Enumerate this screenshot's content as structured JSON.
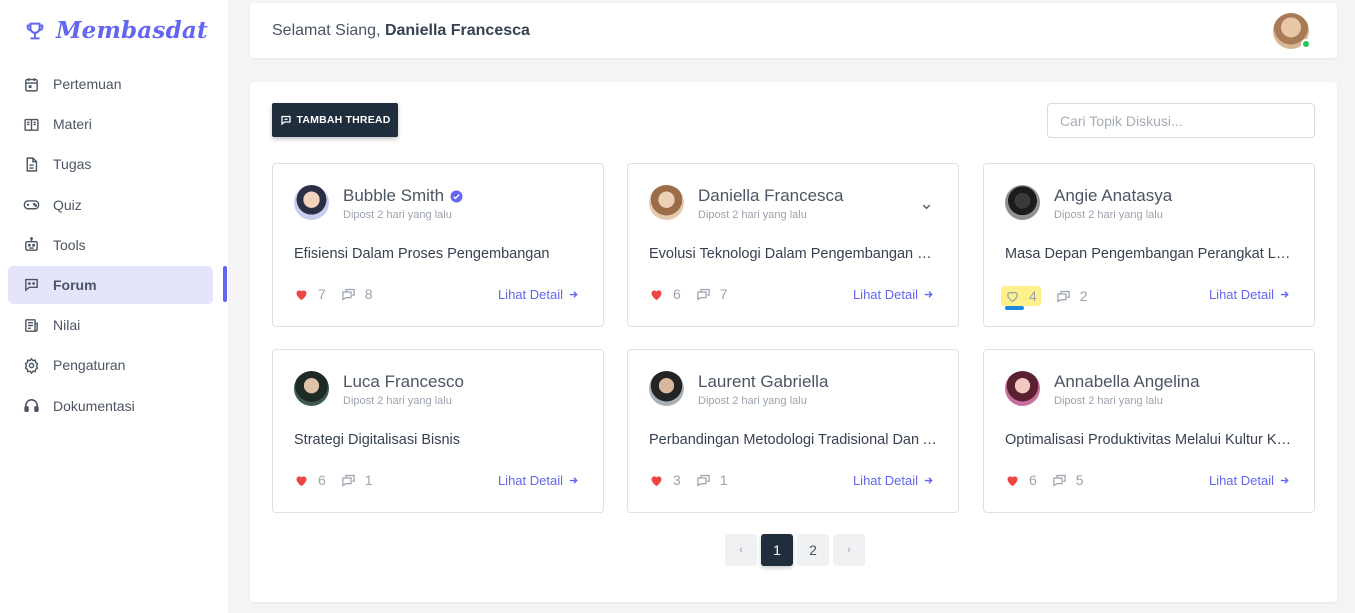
{
  "brand": {
    "name": "Membasdat",
    "accent": "#6366f1"
  },
  "sidebar": {
    "items": [
      {
        "label": "Pertemuan",
        "icon": "calendar-icon",
        "active": false
      },
      {
        "label": "Materi",
        "icon": "book-open-icon",
        "active": false
      },
      {
        "label": "Tugas",
        "icon": "document-icon",
        "active": false
      },
      {
        "label": "Quiz",
        "icon": "gamepad-icon",
        "active": false
      },
      {
        "label": "Tools",
        "icon": "robot-icon",
        "active": false
      },
      {
        "label": "Forum",
        "icon": "chat-icon",
        "active": true
      },
      {
        "label": "Nilai",
        "icon": "report-icon",
        "active": false
      },
      {
        "label": "Pengaturan",
        "icon": "gear-icon",
        "active": false
      },
      {
        "label": "Dokumentasi",
        "icon": "headset-icon",
        "active": false
      }
    ]
  },
  "header": {
    "greeting_prefix": "Selamat Siang, ",
    "user_name": "Daniella Francesca",
    "status_color": "#22c55e"
  },
  "toolbar": {
    "add_thread_label": "TAMBAH THREAD",
    "search_placeholder": "Cari Topik Diskusi..."
  },
  "threads": [
    {
      "author": "Bubble Smith",
      "verified": true,
      "posted": "Dipost 2 hari yang lalu",
      "title": "Efisiensi Dalam Proses Pengembangan",
      "likes": "7",
      "comments": "8",
      "liked": true,
      "detail_label": "Lihat Detail"
    },
    {
      "author": "Daniella Francesca",
      "verified": false,
      "posted": "Dipost 2 hari yang lalu",
      "title": "Evolusi Teknologi Dalam Pengembangan Perangkat Lunak",
      "likes": "6",
      "comments": "7",
      "liked": true,
      "detail_label": "Lihat Detail"
    },
    {
      "author": "Angie Anatasya",
      "verified": false,
      "posted": "Dipost 2 hari yang lalu",
      "title": "Masa Depan Pengembangan Perangkat Lunak",
      "likes": "4",
      "comments": "2",
      "liked": false,
      "detail_label": "Lihat Detail"
    },
    {
      "author": "Luca Francesco",
      "verified": false,
      "posted": "Dipost 2 hari yang lalu",
      "title": "Strategi Digitalisasi Bisnis",
      "likes": "6",
      "comments": "1",
      "liked": true,
      "detail_label": "Lihat Detail"
    },
    {
      "author": "Laurent Gabriella",
      "verified": false,
      "posted": "Dipost 2 hari yang lalu",
      "title": "Perbandingan Metodologi Tradisional Dan Agile",
      "likes": "3",
      "comments": "1",
      "liked": true,
      "detail_label": "Lihat Detail"
    },
    {
      "author": "Annabella Angelina",
      "verified": false,
      "posted": "Dipost 2 hari yang lalu",
      "title": "Optimalisasi Produktivitas Melalui Kultur Kerja",
      "likes": "6",
      "comments": "5",
      "liked": true,
      "detail_label": "Lihat Detail"
    }
  ],
  "pagination": {
    "prev": "‹",
    "pages": [
      "1",
      "2"
    ],
    "current": "1",
    "next": "›"
  },
  "colors": {
    "like_red": "#ef4444",
    "dark": "#1f2d3d",
    "highlight": "#fef08a"
  }
}
